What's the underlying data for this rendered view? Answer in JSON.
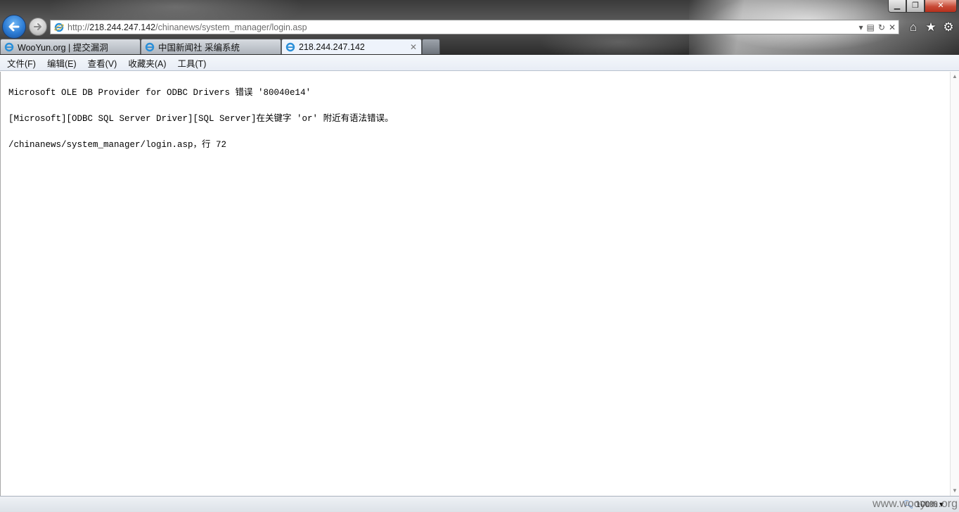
{
  "window": {
    "minimize_glyph": "▁",
    "maximize_glyph": "❐",
    "close_glyph": "✕"
  },
  "address_bar": {
    "url_scheme": "http://",
    "url_host": "218.244.247.142",
    "url_path": "/chinanews/system_manager/login.asp"
  },
  "toolbar": {
    "home_icon": "⌂",
    "favorites_icon": "★",
    "tools_icon": "⚙"
  },
  "tabs": [
    {
      "label": "WooYun.org | 提交漏洞",
      "active": false
    },
    {
      "label": "中国新闻社 采编系统",
      "active": false
    },
    {
      "label": "218.244.247.142",
      "active": true
    }
  ],
  "menu": {
    "file": "文件(F)",
    "edit": "编辑(E)",
    "view": "查看(V)",
    "favorites": "收藏夹(A)",
    "tools": "工具(T)"
  },
  "page": {
    "line1": "Microsoft OLE DB Provider for ODBC Drivers 错误 '80040e14'",
    "line2": "[Microsoft][ODBC SQL Server Driver][SQL Server]在关键字 'or' 附近有语法错误。",
    "line3": "/chinanews/system_manager/login.asp，行 72"
  },
  "status": {
    "zoom": "100%",
    "watermark": "www.wooyun.org"
  },
  "colors": {
    "accent_blue": "#2b7ad3",
    "close_red": "#c74a36"
  }
}
